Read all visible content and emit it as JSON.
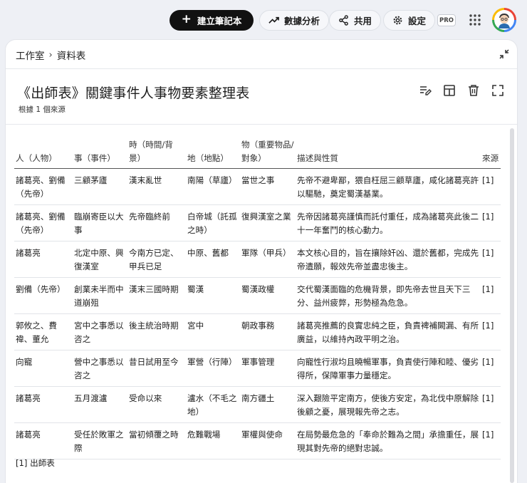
{
  "toolbar": {
    "create_label": "建立筆記本",
    "analytics_label": "數據分析",
    "share_label": "共用",
    "settings_label": "設定",
    "pro_badge": "PRO"
  },
  "breadcrumb": {
    "parent": "工作室",
    "current": "資料表"
  },
  "page": {
    "title": "《出師表》關鍵事件人事物要素整理表",
    "subtitle": "根據 1 個來源"
  },
  "table": {
    "headers": [
      "人（人物）",
      "事（事件）",
      "時（時間/背景）",
      "地（地點）",
      "物（重要物品/對象）",
      "描述與性質",
      "來源"
    ],
    "rows": [
      [
        "諸葛亮、劉備（先帝）",
        "三顧茅廬",
        "漢末亂世",
        "南陽（草廬）",
        "當世之事",
        "先帝不避卑鄙，猥自枉屈三顧草廬，咸化諸葛亮許以驅馳，奠定蜀漢基業。",
        "[1]"
      ],
      [
        "諸葛亮、劉備（先帝）",
        "臨崩寄臣以大事",
        "先帝臨終前",
        "白帝城（託孤之時）",
        "復興漢室之業",
        "先帝因諸葛亮謹慎而託付重任，成為諸葛亮此後二十一年奮鬥的核心動力。",
        "[1]"
      ],
      [
        "諸葛亮",
        "北定中原、興復漢室",
        "今南方已定、甲兵已足",
        "中原、舊都",
        "軍隊（甲兵）",
        "本文核心目的，旨在攘除奸凶、還於舊都，完成先帝遺願，報效先帝並盡忠後主。",
        "[1]"
      ],
      [
        "劉備（先帝）",
        "創業未半而中道崩殂",
        "漢末三國時期",
        "蜀漢",
        "蜀漢政權",
        "交代蜀漢面臨的危機背景，即先帝去世且天下三分、益州疲弊，形勢極為危急。",
        "[1]"
      ],
      [
        "郭攸之、費禕、董允",
        "宮中之事悉以咨之",
        "後主統治時期",
        "宮中",
        "朝政事務",
        "諸葛亮推薦的良實忠純之臣，負責裨補闕漏、有所廣益，以維持內政平明之治。",
        "[1]"
      ],
      [
        "向寵",
        "營中之事悉以咨之",
        "昔日試用至今",
        "軍營（行陣）",
        "軍事管理",
        "向寵性行淑均且曉暢軍事，負責使行陣和睦、優劣得所，保障軍事力量穩定。",
        "[1]"
      ],
      [
        "諸葛亮",
        "五月渡瀘",
        "受命以來",
        "瀘水（不毛之地）",
        "南方疆土",
        "深入艱險平定南方，使後方安定，為北伐中原解除後顧之憂，展現報先帝之志。",
        "[1]"
      ],
      [
        "諸葛亮",
        "受任於敗軍之際",
        "當初傾覆之時",
        "危難戰場",
        "軍權與使命",
        "在局勢最危急的「奉命於難為之間」承擔重任，展現其對先帝的絕對忠誠。",
        "[1]"
      ]
    ]
  },
  "footnote": "[1] 出師表"
}
